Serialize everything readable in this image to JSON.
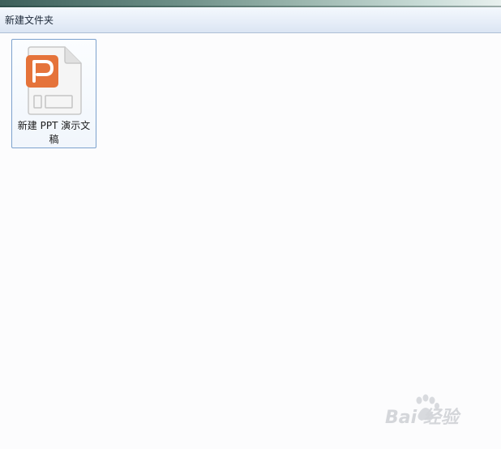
{
  "window": {
    "folder_title": "新建文件夹"
  },
  "files": [
    {
      "name": "新建 PPT 演示文稿",
      "icon": "ppt-document-icon"
    }
  ],
  "watermark": {
    "text": "Bai 经验",
    "logo": "baidu-paw-icon"
  },
  "colors": {
    "ppt_accent": "#e5733a",
    "selection_border": "#7da2ce"
  }
}
